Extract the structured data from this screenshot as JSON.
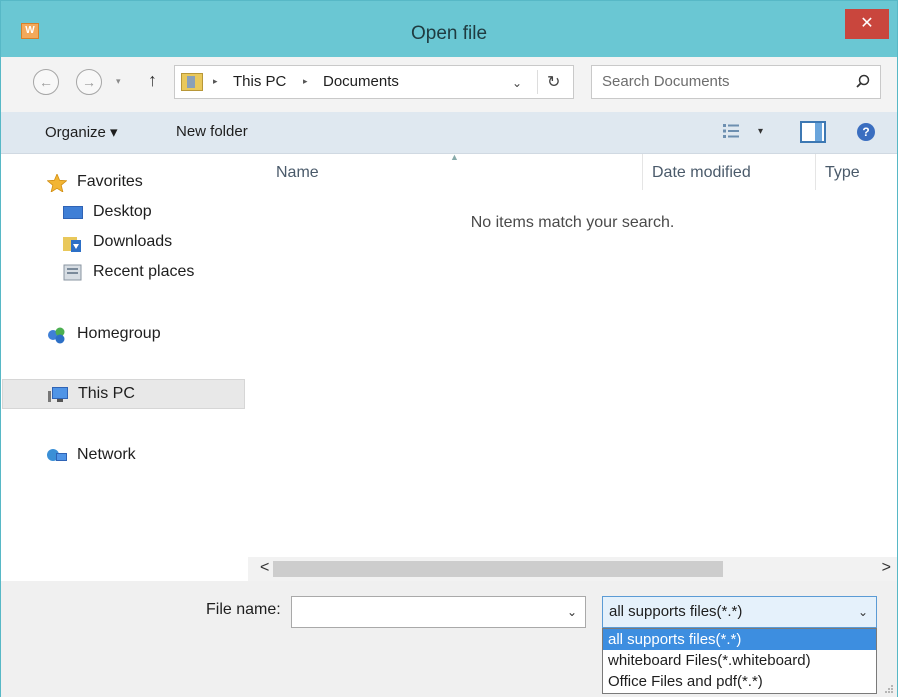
{
  "window": {
    "title": "Open file",
    "close_symbol": "✕",
    "app_icon_letter": "W"
  },
  "address_bar": {
    "back_symbol": "←",
    "forward_symbol": "→",
    "recent_symbol": "▾",
    "up_symbol": "↑",
    "breadcrumb": [
      "This PC",
      "Documents"
    ],
    "crumb_separator": "▸",
    "dropdown_symbol": "⌄",
    "refresh_symbol": "↻"
  },
  "search": {
    "placeholder": "Search Documents"
  },
  "toolbar": {
    "organize_label": "Organize ▾",
    "new_folder_label": "New folder",
    "view_drop": "▾",
    "help_symbol": "?"
  },
  "nav_pane": {
    "favorites": "Favorites",
    "desktop": "Desktop",
    "downloads": "Downloads",
    "recent_places": "Recent places",
    "homegroup": "Homegroup",
    "this_pc": "This PC",
    "network": "Network"
  },
  "file_list": {
    "columns": [
      "Name",
      "Date modified",
      "Type"
    ],
    "sort_indicator": "▲",
    "empty_message": "No items match your search."
  },
  "scrollbar": {
    "left": "<",
    "right": ">"
  },
  "bottom": {
    "file_name_label": "File name:",
    "file_name_value": "",
    "file_name_dropdown": "⌄",
    "file_type_selected": "all supports files(*.*)",
    "file_type_dropdown": "⌄",
    "file_type_options": [
      "all supports files(*.*)",
      "whiteboard Files(*.whiteboard)",
      "Office Files and pdf(*.*)"
    ]
  },
  "colors": {
    "titlebar": "#6ac7d3",
    "close": "#c9463d",
    "selection": "#3d8ee0",
    "toolbar": "#dfe8f0"
  }
}
